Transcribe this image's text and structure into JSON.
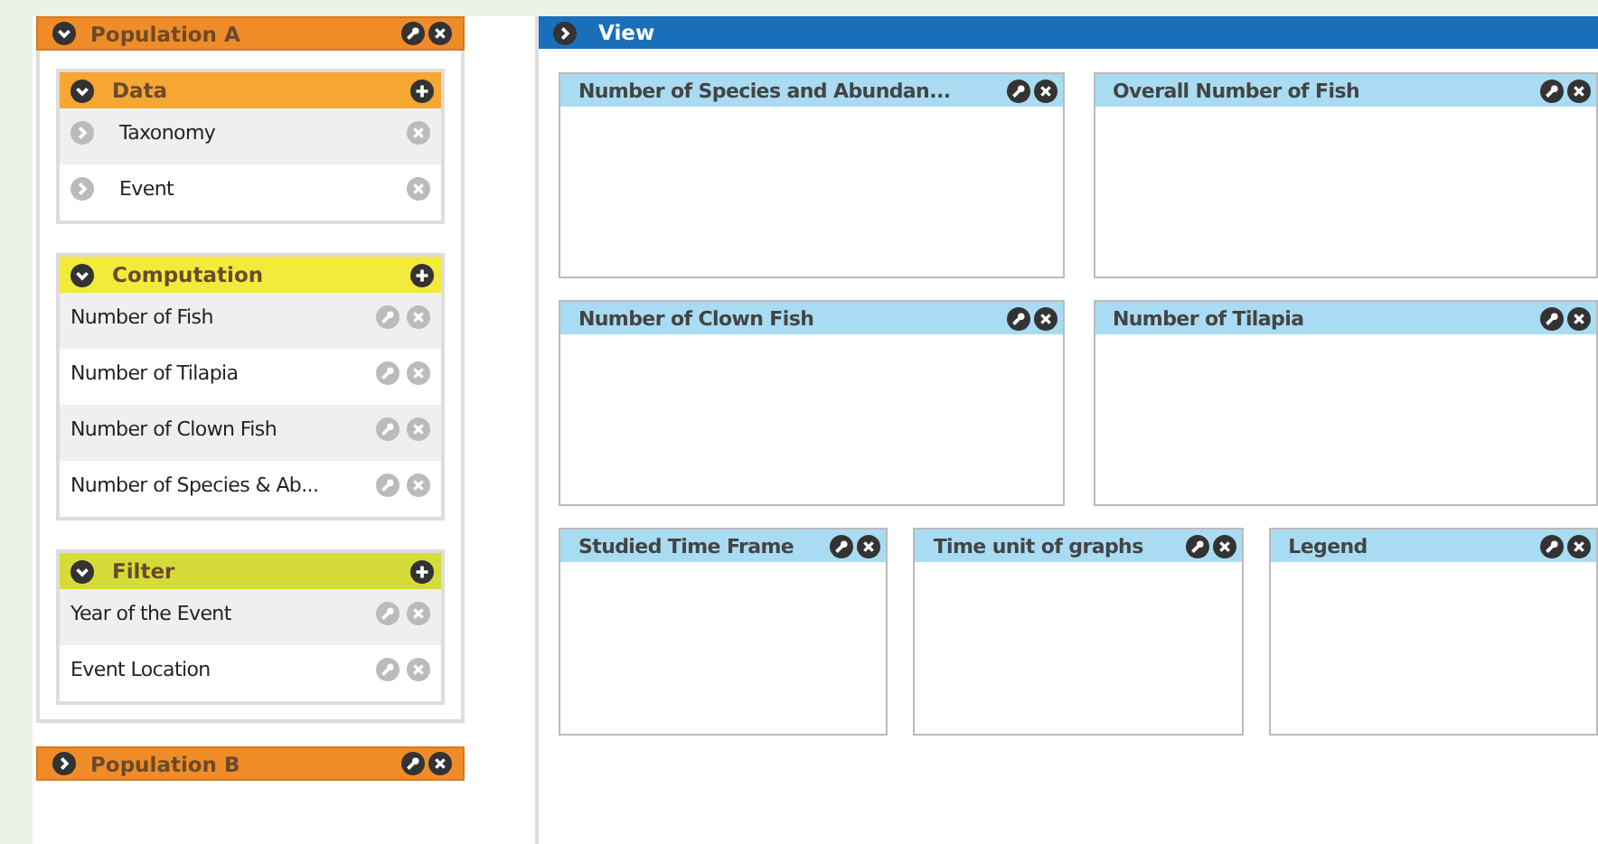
{
  "populations": [
    {
      "title": "Population A",
      "expanded": true,
      "sections": [
        {
          "title": "Data",
          "color": "#f5a633",
          "items": [
            {
              "label": "Taxonomy",
              "kind": "data"
            },
            {
              "label": "Event",
              "kind": "data"
            }
          ]
        },
        {
          "title": "Computation",
          "color": "#f3ea3b",
          "items": [
            {
              "label": "Number of Fish",
              "kind": "tool"
            },
            {
              "label": "Number of Tilapia",
              "kind": "tool"
            },
            {
              "label": "Number of Clown Fish",
              "kind": "tool"
            },
            {
              "label": "Number of Species & Ab...",
              "kind": "tool"
            }
          ]
        },
        {
          "title": "Filter",
          "color": "#d5dc3a",
          "items": [
            {
              "label": "Year of the Event",
              "kind": "tool"
            },
            {
              "label": "Event Location",
              "kind": "tool"
            }
          ]
        }
      ]
    },
    {
      "title": "Population B",
      "expanded": false
    }
  ],
  "view": {
    "title": "View",
    "expanded": false,
    "rows": [
      {
        "cards": [
          {
            "title": "Number of Species and Abundan..."
          },
          {
            "title": "Overall Number of Fish"
          }
        ]
      },
      {
        "cards": [
          {
            "title": "Number of Clown Fish"
          },
          {
            "title": "Number of Tilapia"
          }
        ]
      },
      {
        "cards": [
          {
            "title": "Studied Time Frame"
          },
          {
            "title": "Time unit of graphs"
          },
          {
            "title": "Legend"
          }
        ]
      }
    ]
  }
}
